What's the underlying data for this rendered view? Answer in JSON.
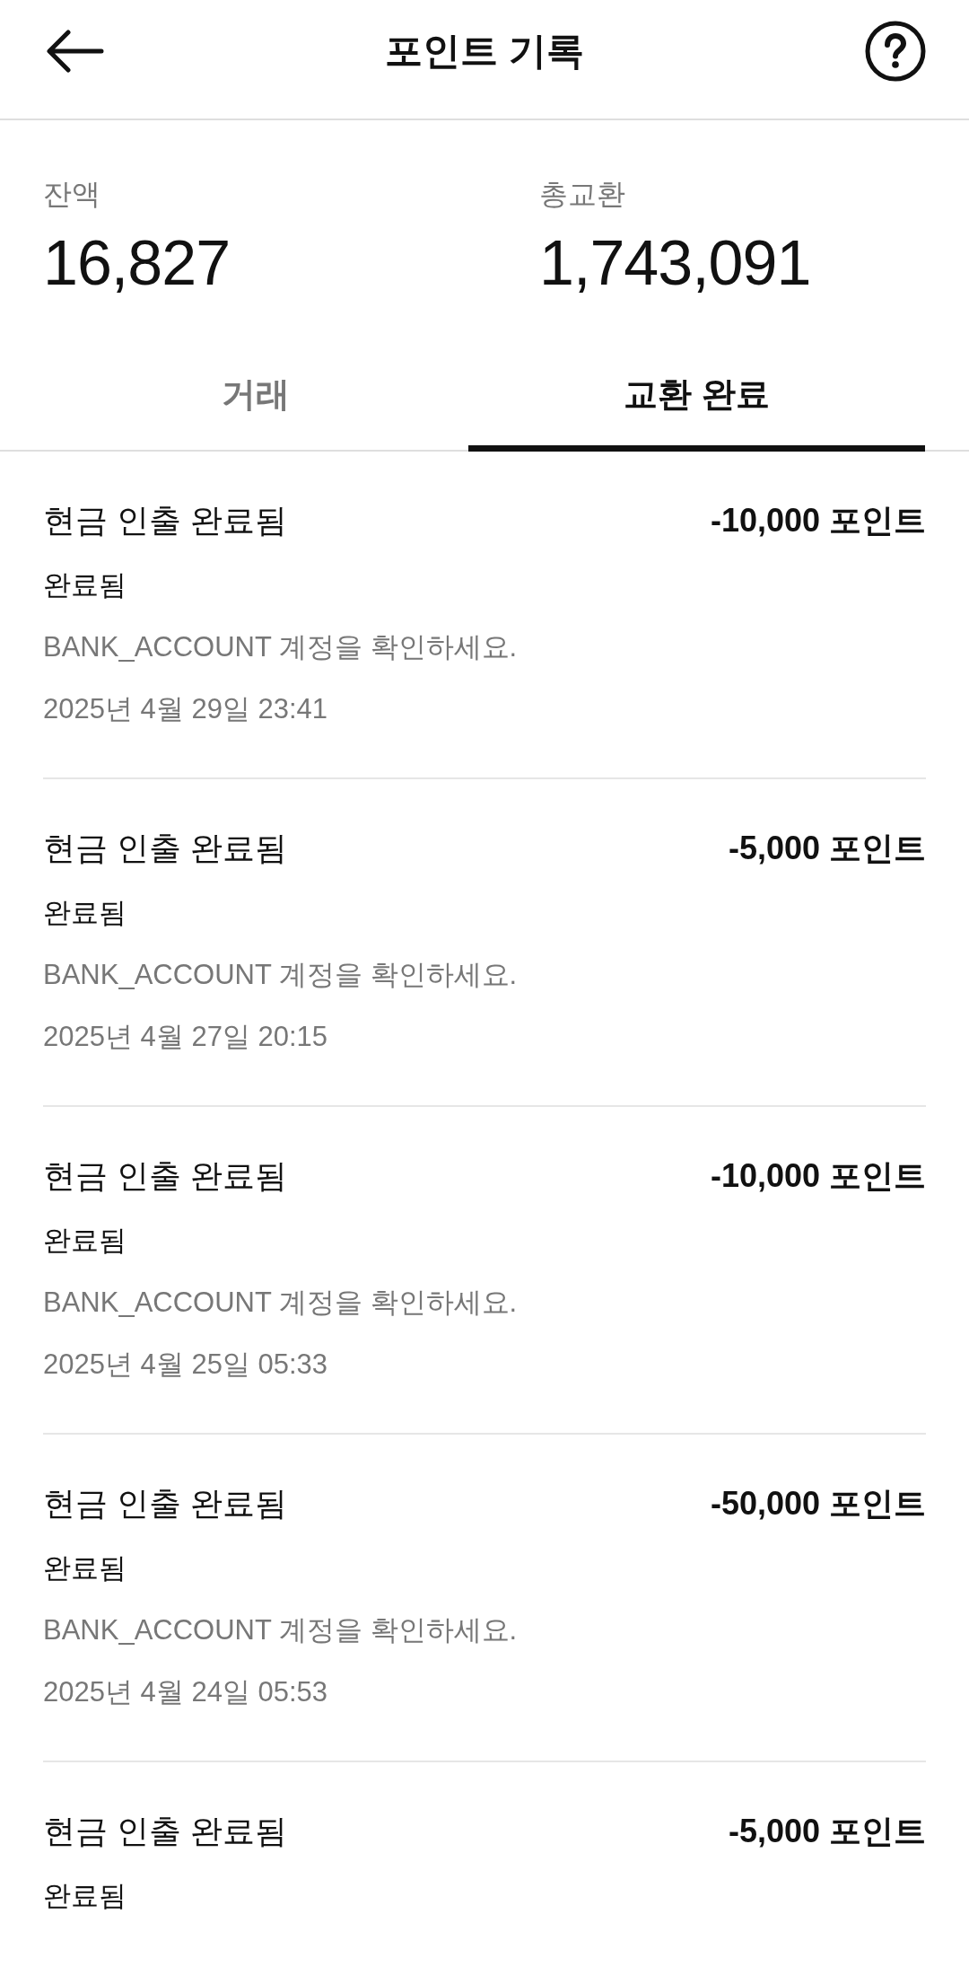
{
  "header": {
    "title": "포인트 기록"
  },
  "summary": [
    {
      "label": "잔액",
      "value": "16,827"
    },
    {
      "label": "총교환",
      "value": "1,743,091"
    }
  ],
  "tabs": [
    {
      "label": "거래",
      "selected": false
    },
    {
      "label": "교환 완료",
      "selected": true
    }
  ],
  "records": [
    {
      "title": "현금 인출 완료됨",
      "amount": "-10,000 포인트",
      "status": "완료됨",
      "note": "BANK_ACCOUNT 계정을 확인하세요.",
      "date": "2025년 4월 29일 23:41"
    },
    {
      "title": "현금 인출 완료됨",
      "amount": "-5,000 포인트",
      "status": "완료됨",
      "note": "BANK_ACCOUNT 계정을 확인하세요.",
      "date": "2025년 4월 27일 20:15"
    },
    {
      "title": "현금 인출 완료됨",
      "amount": "-10,000 포인트",
      "status": "완료됨",
      "note": "BANK_ACCOUNT 계정을 확인하세요.",
      "date": "2025년 4월 25일 05:33"
    },
    {
      "title": "현금 인출 완료됨",
      "amount": "-50,000 포인트",
      "status": "완료됨",
      "note": "BANK_ACCOUNT 계정을 확인하세요.",
      "date": "2025년 4월 24일 05:53"
    },
    {
      "title": "현금 인출 완료됨",
      "amount": "-5,000 포인트",
      "status": "완료됨"
    }
  ]
}
